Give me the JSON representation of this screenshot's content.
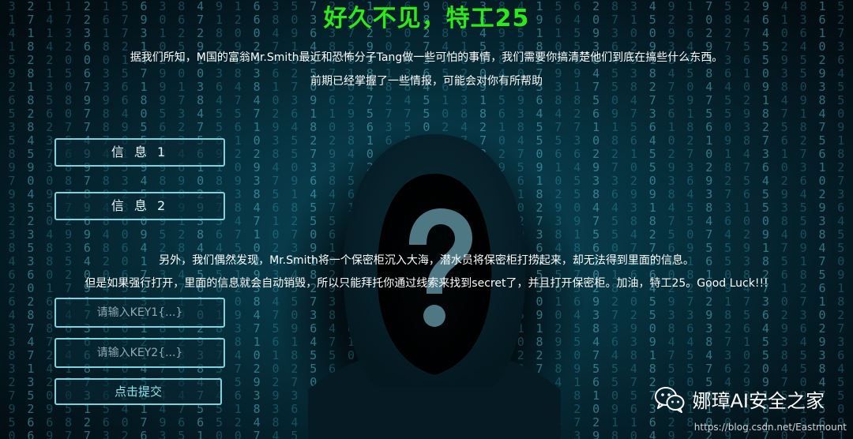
{
  "header": {
    "title": "好久不见，特工25"
  },
  "intro": {
    "line1": "据我们所知，M国的富翁Mr.Smith最近和恐怖分子Tang做一些可怕的事情，我们需要你搞清楚他们到底在搞些什么东西。",
    "line2": "前期已经掌握了一些情报，可能会对你有所帮助"
  },
  "buttons": {
    "info1": "信 息 1",
    "info2": "信 息 2",
    "submit": "点击提交"
  },
  "story": {
    "line1": "另外，我们偶然发现，Mr.Smith将一个保密柜沉入大海，潜水员将保密柜打捞起来，却无法得到里面的信息。",
    "line2": "但是如果强行打开，里面的信息就会自动销毁，所以只能拜托你通过线索来找到secret了，并且打开保密柜。加油，特工25。Good Luck!!!"
  },
  "form": {
    "key1_placeholder": "请输入KEY1{...}",
    "key1_value": "",
    "key2_placeholder": "请输入KEY2{...}",
    "key2_value": ""
  },
  "watermark": {
    "brand": "娜璋AI安全之家",
    "url": "https://blog.csdn.net/Eastmount"
  },
  "icons": {
    "background": "hooded-hacker-question-mark",
    "watermark": "wechat-icon"
  },
  "colors": {
    "title": "#2fe81a",
    "button_border": "#7ed4dc",
    "background": "#041a24"
  }
}
